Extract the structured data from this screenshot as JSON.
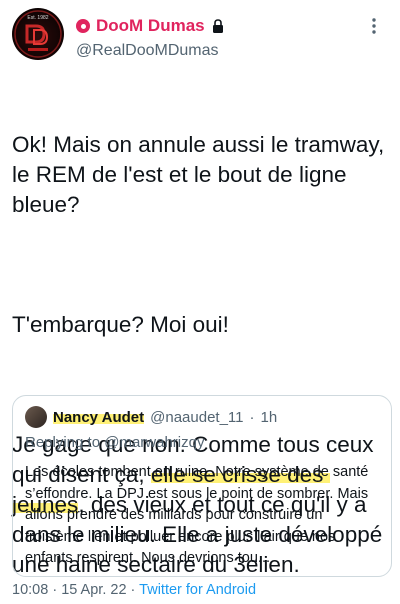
{
  "author": {
    "display_name": "DooM Dumas",
    "handle": "@RealDooMDumas",
    "avatar_text": "Est. 1982"
  },
  "tweet": {
    "paragraph_1": "Ok! Mais on annule aussi le tramway, le REM de l'est et le bout de ligne bleue?",
    "paragraph_2": "T'embarque? Moi oui!",
    "paragraph_3_before": "Je gage que non. Comme tous ceux qui disent ça, ",
    "paragraph_3_highlight": "elle se crisse des jeunes",
    "paragraph_3_after": ", des vieux et tout ce qu'il y a dans le milieu. Elle a juste développé une haine sectaire du 3elien."
  },
  "quote": {
    "name": "Nancy Audet",
    "handle": "@naaudet_11",
    "separator": "·",
    "time": "1h",
    "replying_prefix": "Replying to ",
    "replying_to": "@marwahrizqy",
    "body": "Les écoles tombent en ruine. Notre système de santé s’effondre. La DPJ est sous le point de sombrer. Mais allons prendre des milliards pour construire un troisième lien et polluer encore plus l’air que nos enfants respirent. Nous devrions tou..."
  },
  "footer": {
    "time": "10:08",
    "sep1": "·",
    "date": "15 Apr. 22",
    "sep2": "·",
    "source": "Twitter for Android"
  },
  "icons": {
    "pin": "pinned-dot-icon",
    "lock": "lock-icon",
    "more": "more-options-icon"
  },
  "colors": {
    "display_name": "#e0245e",
    "highlight": "#fff176",
    "link": "#1d9bf0"
  }
}
